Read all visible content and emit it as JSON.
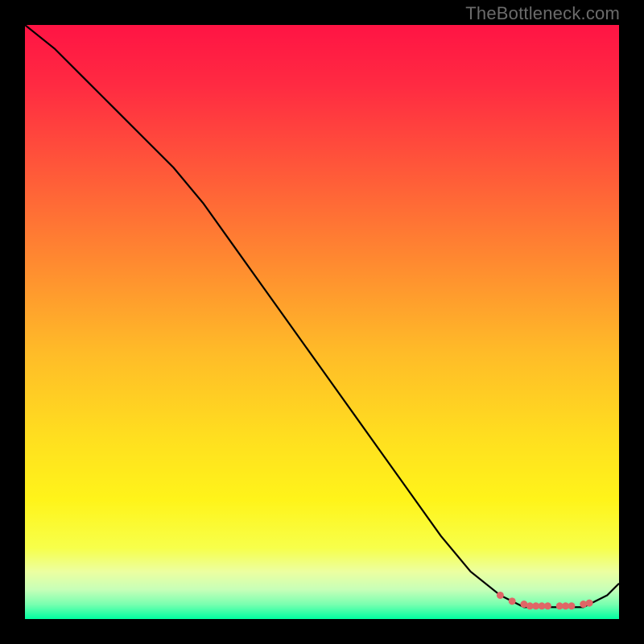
{
  "watermark": "TheBottleneck.com",
  "chart_data": {
    "type": "line",
    "title": "",
    "xlabel": "",
    "ylabel": "",
    "xlim": [
      0,
      100
    ],
    "ylim": [
      0,
      100
    ],
    "grid": false,
    "legend": false,
    "series": [
      {
        "name": "curve",
        "color": "#000000",
        "x": [
          0,
          5,
          10,
          15,
          20,
          25,
          30,
          35,
          40,
          45,
          50,
          55,
          60,
          65,
          70,
          75,
          80,
          82,
          84,
          86,
          88,
          90,
          92,
          94,
          96,
          98,
          100
        ],
        "y": [
          100,
          96,
          91,
          86,
          81,
          76,
          70,
          63,
          56,
          49,
          42,
          35,
          28,
          21,
          14,
          8,
          4,
          3,
          2,
          2,
          2,
          2,
          2,
          2,
          3,
          4,
          6
        ]
      }
    ],
    "markers": {
      "name": "bottom-cluster",
      "color": "#e06666",
      "points": [
        {
          "x": 80,
          "y": 4
        },
        {
          "x": 82,
          "y": 3
        },
        {
          "x": 84,
          "y": 2.5
        },
        {
          "x": 85,
          "y": 2.2
        },
        {
          "x": 86,
          "y": 2.2
        },
        {
          "x": 87,
          "y": 2.2
        },
        {
          "x": 88,
          "y": 2.2
        },
        {
          "x": 90,
          "y": 2.2
        },
        {
          "x": 91,
          "y": 2.2
        },
        {
          "x": 92,
          "y": 2.2
        },
        {
          "x": 94,
          "y": 2.5
        },
        {
          "x": 95,
          "y": 2.7
        }
      ]
    },
    "gradient_stops": [
      {
        "offset": 0.0,
        "color": "#ff1444"
      },
      {
        "offset": 0.1,
        "color": "#ff2a42"
      },
      {
        "offset": 0.25,
        "color": "#ff5a39"
      },
      {
        "offset": 0.4,
        "color": "#ff8a30"
      },
      {
        "offset": 0.55,
        "color": "#ffbb28"
      },
      {
        "offset": 0.7,
        "color": "#ffe01f"
      },
      {
        "offset": 0.8,
        "color": "#fff41a"
      },
      {
        "offset": 0.88,
        "color": "#f7ff4a"
      },
      {
        "offset": 0.92,
        "color": "#ecffa0"
      },
      {
        "offset": 0.95,
        "color": "#c8ffb8"
      },
      {
        "offset": 0.975,
        "color": "#7affb0"
      },
      {
        "offset": 1.0,
        "color": "#00ffa0"
      }
    ]
  }
}
